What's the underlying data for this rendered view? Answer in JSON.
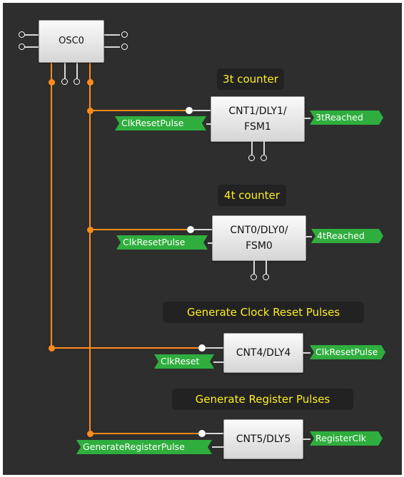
{
  "osc": {
    "label": "OSC0"
  },
  "blocks": {
    "cnt1": {
      "label": "CNT1/DLY1/\nFSM1",
      "title": "3t counter",
      "in_port": "ClkResetPulse",
      "out_port": "3tReached"
    },
    "cnt0": {
      "label": "CNT0/DLY0/\nFSM0",
      "title": "4t counter",
      "in_port": "ClkResetPulse",
      "out_port": "4tReached"
    },
    "cnt4": {
      "label": "CNT4/DLY4",
      "title": "Generate Clock Reset Pulses",
      "in_port": "ClkReset",
      "out_port": "ClkResetPulse"
    },
    "cnt5": {
      "label": "CNT5/DLY5",
      "title": "Generate Register Pulses",
      "in_port": "GenerateRegisterPulse",
      "out_port": "RegisterClk"
    }
  },
  "colors": {
    "background": "#2e2e2e",
    "wire": "#ff8c1a",
    "port": "#2fae3e",
    "title_text": "#ffee22"
  }
}
